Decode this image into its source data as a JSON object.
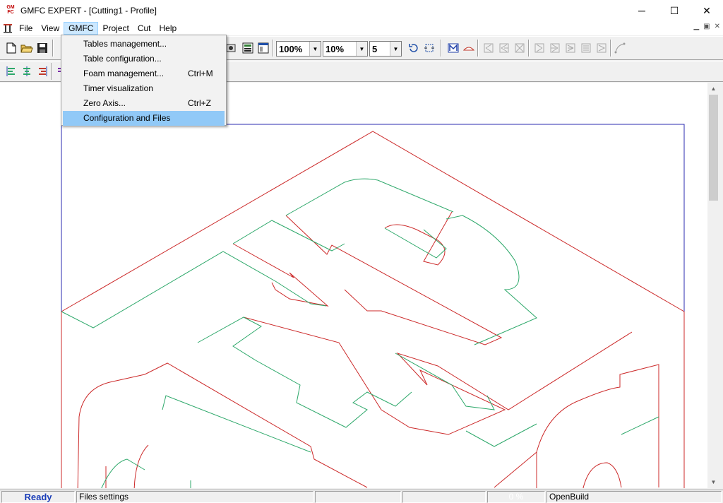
{
  "window": {
    "logo_text": "GM FC",
    "title": "GMFC EXPERT - [Cutting1 - Profile]",
    "minimize": "─",
    "maximize": "☐",
    "close": "✕"
  },
  "menubar": {
    "items": [
      "File",
      "View",
      "GMFC",
      "Project",
      "Cut",
      "Help"
    ],
    "active": "GMFC"
  },
  "gmfc_menu": {
    "items": [
      {
        "label": "Tables management...",
        "shortcut": ""
      },
      {
        "label": "Table configuration...",
        "shortcut": ""
      },
      {
        "label": "Foam management...",
        "shortcut": "Ctrl+M"
      },
      {
        "label": "Timer visualization",
        "shortcut": ""
      },
      {
        "label": "Zero Axis...",
        "shortcut": "Ctrl+Z"
      },
      {
        "label": "Configuration and Files",
        "shortcut": ""
      }
    ],
    "highlighted_index": 5
  },
  "toolbar": {
    "zoom_value": "100%",
    "step_value": "10%",
    "count_value": "5"
  },
  "statusbar": {
    "ready": "Ready",
    "message": "Files settings",
    "progress": "0 %",
    "mode": "OpenBuild"
  },
  "colors": {
    "frame": "#2b2bb0",
    "cut_path": "#cc2a2a",
    "profile_path": "#2da86a",
    "menu_highlight": "#91c9f7"
  }
}
